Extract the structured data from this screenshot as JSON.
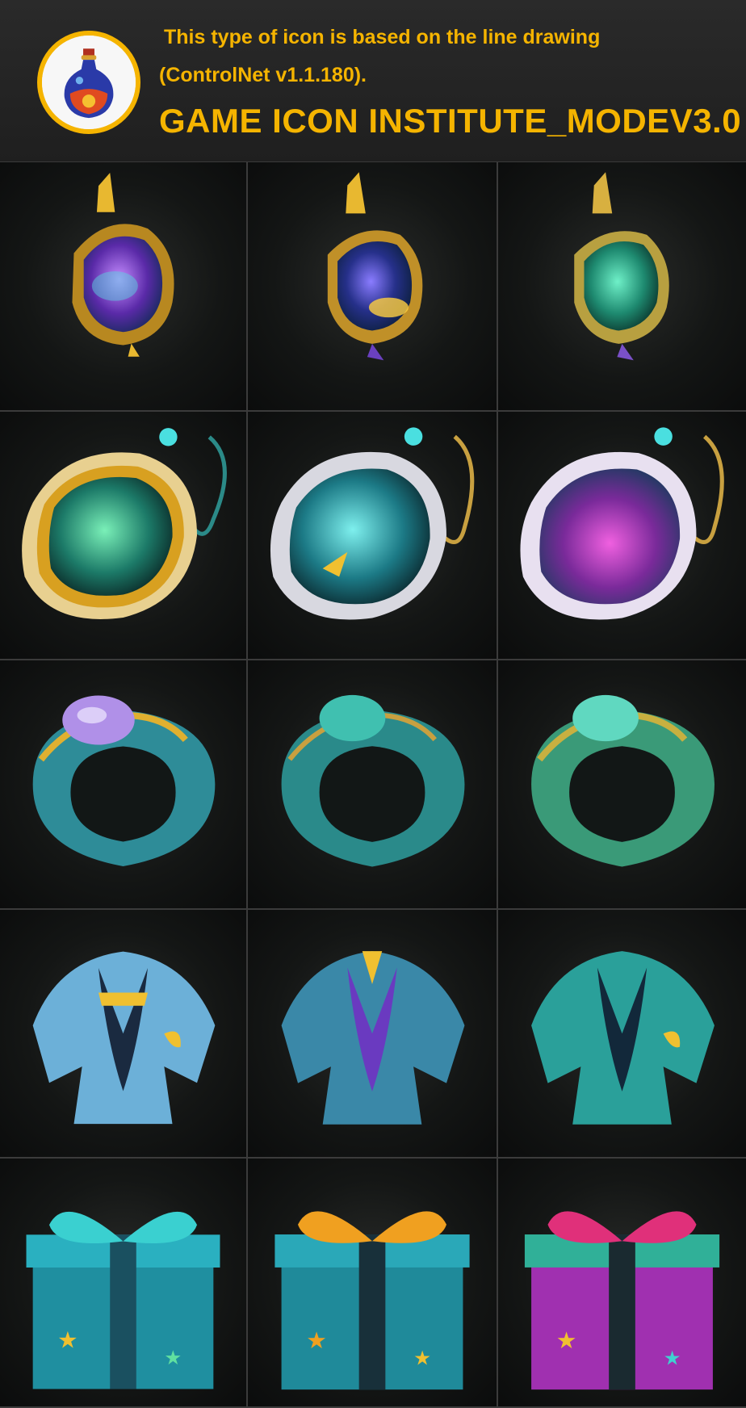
{
  "header": {
    "line1": "This type of icon is based on the line drawing",
    "line2": "(ControlNet v1.1.180).",
    "title": "GAME ICON INSTITUTE_MODEV3.0",
    "logo_icon": "potion-bottle-icon",
    "accent_color": "#f5b400"
  },
  "grid": {
    "rows": [
      {
        "item": "amulet-pendant-icon",
        "variants": [
          "purple",
          "blue-gold",
          "teal"
        ]
      },
      {
        "item": "orb-pendant-icon",
        "variants": [
          "green-gold",
          "teal",
          "magenta"
        ]
      },
      {
        "item": "ring-icon",
        "variants": [
          "amethyst",
          "teal",
          "green"
        ]
      },
      {
        "item": "robe-icon",
        "variants": [
          "light-blue",
          "blue-purple",
          "teal"
        ]
      },
      {
        "item": "gift-box-icon",
        "variants": [
          "teal",
          "orange-bow",
          "pink"
        ]
      }
    ],
    "colors": {
      "gold": "#e8b830",
      "teal": "#2bb5b0",
      "purple": "#8a4fd8",
      "magenta": "#c230a8",
      "pink": "#e0307a",
      "orange": "#f0a020",
      "light_blue": "#6cc8e8",
      "green": "#3fc08a"
    }
  }
}
